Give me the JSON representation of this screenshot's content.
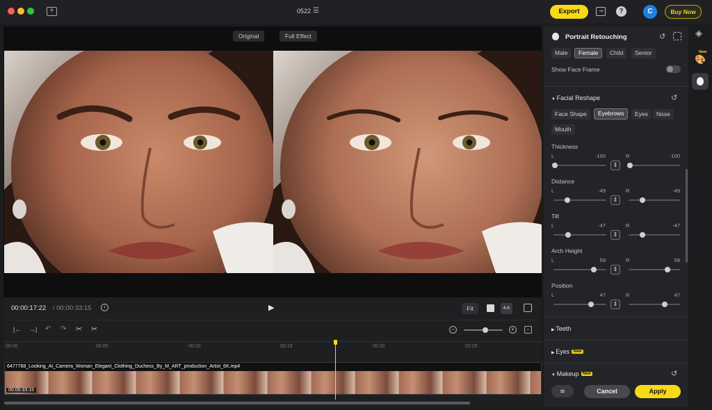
{
  "window": {
    "title": "0522"
  },
  "topbar": {
    "export_label": "Export",
    "buy_label": "Buy Now",
    "avatar_letter": "C",
    "accent": "#f7d916"
  },
  "preview": {
    "original_label": "Original",
    "full_effect_label": "Full Effect"
  },
  "playback": {
    "current_time": "00:00:17:22",
    "total_time": "/ 00:00:33:15",
    "fit_label": "Fit",
    "ratio_label": "4:A"
  },
  "timeline": {
    "ticks": [
      "00:00",
      "00:05",
      "00:10",
      "00:15",
      "00:20",
      "00:25"
    ],
    "clip_name": "6477768_Looking_At_Camera_Woman_Elegant_Clothing_Duchess_By_M_ART_production_Artist_6K.mp4",
    "clip_duration": "00:00:33:15"
  },
  "panel": {
    "title": "Portrait Retouching",
    "genders": [
      "Male",
      "Female",
      "Child",
      "Senior"
    ],
    "gender_selected": "Female",
    "show_face_frame_label": "Show Face Frame",
    "facial_reshape_label": "Facial Reshape",
    "reshape_tabs": [
      "Face Shape",
      "Eyebrows",
      "Eyes",
      "Nose",
      "Mouth"
    ],
    "reshape_selected": "Eyebrows",
    "left_label": "L",
    "right_label": "R",
    "sliders": [
      {
        "label": "Thickness",
        "left_value": "-100",
        "right_value": "-100",
        "left_level": 0.0,
        "right_level": 0.0
      },
      {
        "label": "Distance",
        "left_value": "-49",
        "right_value": "-49",
        "left_level": 0.26,
        "right_level": 0.26
      },
      {
        "label": "Tilt",
        "left_value": "-47",
        "right_value": "-47",
        "left_level": 0.27,
        "right_level": 0.27
      },
      {
        "label": "Arch Height",
        "left_value": "59",
        "right_value": "59",
        "left_level": 0.8,
        "right_level": 0.8
      },
      {
        "label": "Position",
        "left_value": "47",
        "right_value": "47",
        "left_level": 0.74,
        "right_level": 0.74
      }
    ],
    "teeth_label": "Teeth",
    "eyes_label": "Eyes",
    "makeup_label": "Makeup",
    "new_badge": "New",
    "cancel_label": "Cancel",
    "apply_label": "Apply"
  },
  "rail": {
    "new_badge": "New"
  }
}
